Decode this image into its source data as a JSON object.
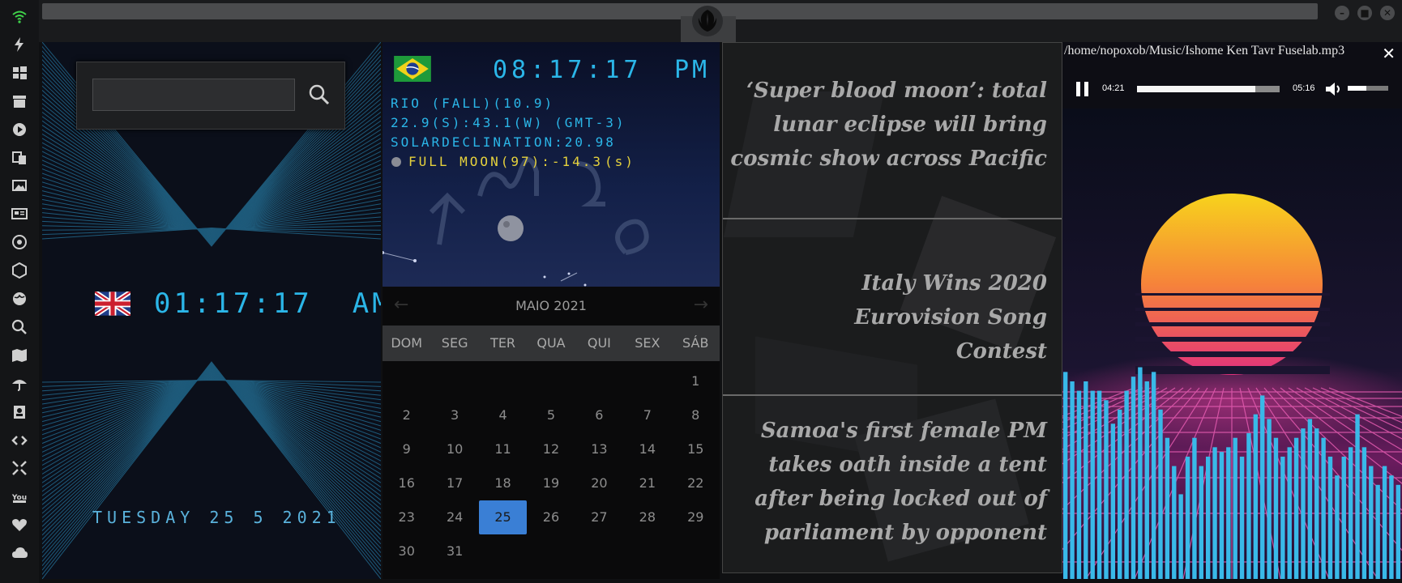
{
  "sidebar": {
    "icons": [
      "wifi-icon",
      "bolt-icon",
      "windows-icon",
      "archive-icon",
      "play-circle-icon",
      "translate-icon",
      "image-icon",
      "newspaper-icon",
      "settings-icon",
      "hexagon-icon",
      "globe-icon",
      "search-icon",
      "map-icon",
      "umbrella-icon",
      "contacts-icon",
      "code-icon",
      "expand-icon",
      "youtube-icon",
      "heart-icon",
      "cloud-icon"
    ],
    "accent": "#3fd24a"
  },
  "window": {
    "controls": [
      "minimize",
      "maximize",
      "close"
    ]
  },
  "clock_uk": {
    "time": "01:17:17",
    "ampm": "AM",
    "date": "TUESDAY 25 5 2021",
    "search_placeholder": ""
  },
  "clock_br": {
    "time": "08:17:17",
    "ampm": "PM",
    "line1": "RIO (FALL)(10.9)",
    "line2": "22.9(S):43.1(W) (GMT-3)",
    "line3": "SOLARDECLINATION:20.98",
    "moon": "FULL MOON(97):-14.3",
    "moon_suffix": "(s)"
  },
  "calendar": {
    "title": "MAIO 2021",
    "prev": "←",
    "next": "→",
    "dow": [
      "DOM",
      "SEG",
      "TER",
      "QUA",
      "QUI",
      "SEX",
      "SÁB"
    ],
    "weeks": [
      [
        "",
        "",
        "",
        "",
        "",
        "",
        "1"
      ],
      [
        "2",
        "3",
        "4",
        "5",
        "6",
        "7",
        "8"
      ],
      [
        "9",
        "10",
        "11",
        "12",
        "13",
        "14",
        "15"
      ],
      [
        "16",
        "17",
        "18",
        "19",
        "20",
        "21",
        "22"
      ],
      [
        "23",
        "24",
        "25",
        "26",
        "27",
        "28",
        "29"
      ],
      [
        "30",
        "31",
        "",
        "",
        "",
        "",
        ""
      ]
    ],
    "selected": "25",
    "selected_color": "#3a7fd5"
  },
  "news": [
    "‘Super blood moon’: total lunar eclipse will bring cosmic show across Pacific",
    "Italy Wins 2020 Eurovision Song Contest",
    "Samoa's first female PM takes oath inside a tent after being locked out of parliament by opponent"
  ],
  "player": {
    "path": "/home/nopoxob/Music/Ishome Ken Tavr Fuselab.mp3",
    "close": "✕",
    "elapsed": "04:21",
    "duration": "05:16",
    "progress": 0.83,
    "volume": 0.45,
    "state": "playing",
    "visualizer": [
      0.44,
      0.42,
      0.4,
      0.42,
      0.4,
      0.4,
      0.38,
      0.33,
      0.36,
      0.4,
      0.43,
      0.45,
      0.42,
      0.44,
      0.36,
      0.3,
      0.24,
      0.18,
      0.26,
      0.3,
      0.24,
      0.26,
      0.28,
      0.27,
      0.28,
      0.3,
      0.26,
      0.31,
      0.35,
      0.39,
      0.34,
      0.3,
      0.26,
      0.28,
      0.3,
      0.32,
      0.34,
      0.32,
      0.3,
      0.26,
      0.22,
      0.26,
      0.28,
      0.35,
      0.28,
      0.24,
      0.2,
      0.24,
      0.22,
      0.2
    ]
  }
}
